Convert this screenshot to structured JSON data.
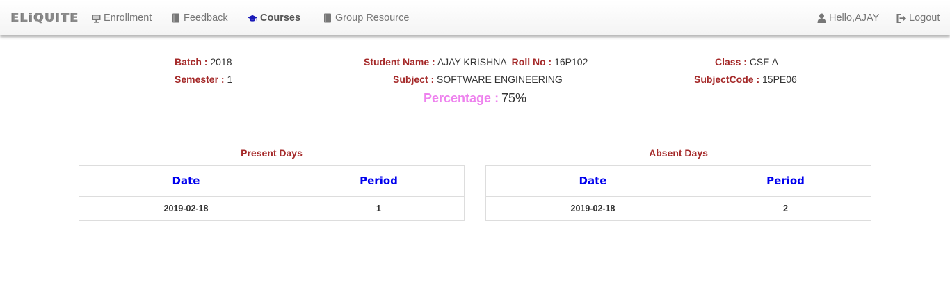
{
  "navbar": {
    "brand": "ELiQUITE",
    "items": [
      {
        "label": "Enrollment",
        "icon": "chalkboard-icon"
      },
      {
        "label": "Feedback",
        "icon": "book-icon"
      },
      {
        "label": "Courses",
        "icon": "graduation-cap-icon",
        "active": true
      },
      {
        "label": "Group Resource",
        "icon": "book-icon"
      }
    ],
    "user": {
      "label": "Hello,AJAY",
      "icon": "user-icon"
    },
    "logout": {
      "label": "Logout",
      "icon": "logout-icon"
    }
  },
  "info": {
    "batch_label": "Batch :",
    "batch_value": "2018",
    "semester_label": "Semester :",
    "semester_value": "1",
    "student_label": "Student Name :",
    "student_value": "AJAY KRISHNA",
    "roll_label": "Roll No :",
    "roll_value": "16P102",
    "subject_label": "Subject :",
    "subject_value": "SOFTWARE ENGINEERING",
    "class_label": "Class :",
    "class_value": "CSE A",
    "subjectcode_label": "SubjectCode :",
    "subjectcode_value": "15PE06",
    "percentage_label": "Percentage :",
    "percentage_value": "75%"
  },
  "present": {
    "title": "Present Days",
    "headers": [
      "Date",
      "Period"
    ],
    "rows": [
      [
        "2019-02-18",
        "1"
      ]
    ]
  },
  "absent": {
    "title": "Absent Days",
    "headers": [
      "Date",
      "Period"
    ],
    "rows": [
      [
        "2019-02-18",
        "2"
      ]
    ]
  },
  "colors": {
    "label": "#a52a2a",
    "percentage_label": "#ee82ee",
    "table_header": "#0000ee",
    "active_nav_icon": "#1a1ab8"
  }
}
